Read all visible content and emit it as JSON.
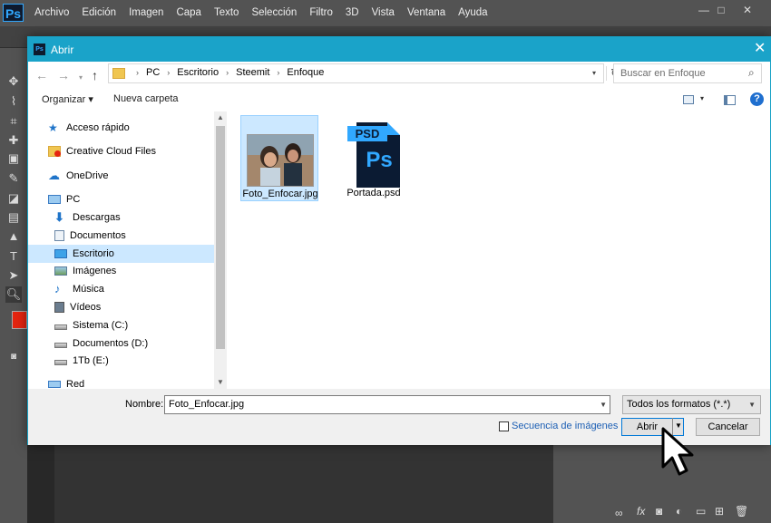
{
  "photoshop": {
    "logo": "Ps",
    "menu": [
      "Archivo",
      "Edición",
      "Imagen",
      "Capa",
      "Texto",
      "Selección",
      "Filtro",
      "3D",
      "Vista",
      "Ventana",
      "Ayuda"
    ],
    "window_controls": [
      "—",
      "□",
      "✕"
    ]
  },
  "dialog": {
    "title": "Abrir",
    "app_icon": "Ps",
    "breadcrumb": [
      "PC",
      "Escritorio",
      "Steemit",
      "Enfoque"
    ],
    "search_placeholder": "Buscar en Enfoque",
    "organize_label": "Organizar ▾",
    "new_folder_label": "Nueva carpeta",
    "help_label": "?",
    "nav_pane": [
      {
        "label": "Acceso rápido",
        "icon": "star-icon",
        "selected": false
      },
      {
        "label": "Creative Cloud Files",
        "icon": "creative-cloud-folder-icon",
        "selected": false
      },
      {
        "label": "OneDrive",
        "icon": "cloud-icon",
        "selected": false
      },
      {
        "label": "PC",
        "icon": "computer-icon",
        "selected": false
      },
      {
        "label": "Descargas",
        "icon": "downloads-icon",
        "selected": false
      },
      {
        "label": "Documentos",
        "icon": "documents-icon",
        "selected": false
      },
      {
        "label": "Escritorio",
        "icon": "desktop-icon",
        "selected": true
      },
      {
        "label": "Imágenes",
        "icon": "pictures-icon",
        "selected": false
      },
      {
        "label": "Música",
        "icon": "music-icon",
        "selected": false
      },
      {
        "label": "Vídeos",
        "icon": "videos-icon",
        "selected": false
      },
      {
        "label": "Sistema (C:)",
        "icon": "drive-icon",
        "selected": false
      },
      {
        "label": "Documentos (D:)",
        "icon": "drive-icon",
        "selected": false
      },
      {
        "label": "1Tb (E:)",
        "icon": "drive-icon",
        "selected": false
      },
      {
        "label": "Red",
        "icon": "network-icon",
        "selected": false
      }
    ],
    "files": [
      {
        "name": "Foto_Enfocar.jpg",
        "icon": "photo-thumbnail",
        "selected": true
      },
      {
        "name": "Portada.psd",
        "icon": "psd-file-icon",
        "selected": false
      }
    ],
    "psd_badge": "PSD",
    "psd_logo": "Ps",
    "filename_label": "Nombre:",
    "filename_value": "Foto_Enfocar.jpg",
    "file_type_value": "Todos los formatos (*.*)",
    "sequence_label": "Secuencia de imágenes",
    "open_button": "Abrir",
    "cancel_button": "Cancelar"
  },
  "colors": {
    "title_bar": "#1aa3c9",
    "selection": "#cce8ff",
    "ps_foreground_swatch": "#e52510",
    "link_blue": "#1c5fb4"
  }
}
